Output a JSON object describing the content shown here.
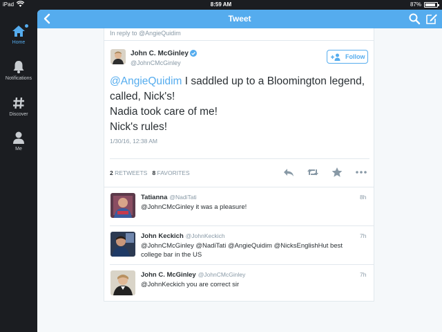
{
  "status_bar": {
    "carrier": "iPad",
    "time": "8:59 AM",
    "battery": "87%"
  },
  "sidebar": {
    "items": [
      {
        "label": "Home",
        "icon": "home-icon",
        "active": true
      },
      {
        "label": "Notifications",
        "icon": "bell-icon",
        "active": false
      },
      {
        "label": "Discover",
        "icon": "hashtag-icon",
        "active": false
      },
      {
        "label": "Me",
        "icon": "person-icon",
        "active": false
      }
    ]
  },
  "header": {
    "title": "Tweet",
    "back_icon": "chevron-left-icon",
    "search_icon": "search-icon",
    "compose_icon": "compose-icon"
  },
  "tweet": {
    "reply_context_prefix": "In reply to",
    "reply_context_user": "@AngieQuidim",
    "author_name": "John C. McGinley",
    "author_handle": "@JohnCMcGinley",
    "verified": true,
    "follow_label": "Follow",
    "text_mention": "@AngieQuidim",
    "text_line1": " I saddled up to a Bloomington legend, called, Nick's!",
    "text_line2": "Nadia took care of me!",
    "text_line3": "Nick's rules!",
    "timestamp": "1/30/16, 12:38 AM",
    "retweets_count": "2",
    "retweets_label": "RETWEETS",
    "favorites_count": "8",
    "favorites_label": "FAVORITES"
  },
  "replies": [
    {
      "name": "Tatianna",
      "handle": "@NadiTati",
      "time": "8h",
      "text": "@JohnCMcGinley it was a pleasure!"
    },
    {
      "name": "John Keckich",
      "handle": "@JohnKeckich",
      "time": "7h",
      "text": "@JohnCMcGinley @NadiTati @AngieQuidim @NicksEnglishHut best college bar in the US"
    },
    {
      "name": "John C. McGinley",
      "handle": "@JohnCMcGinley",
      "time": "7h",
      "text": "@JohnKeckich you are correct sir"
    }
  ],
  "colors": {
    "accent": "#55acee",
    "sidebar_bg": "#1b1d21",
    "panel_bg": "#f5f8fa",
    "muted_text": "#8899a6"
  }
}
